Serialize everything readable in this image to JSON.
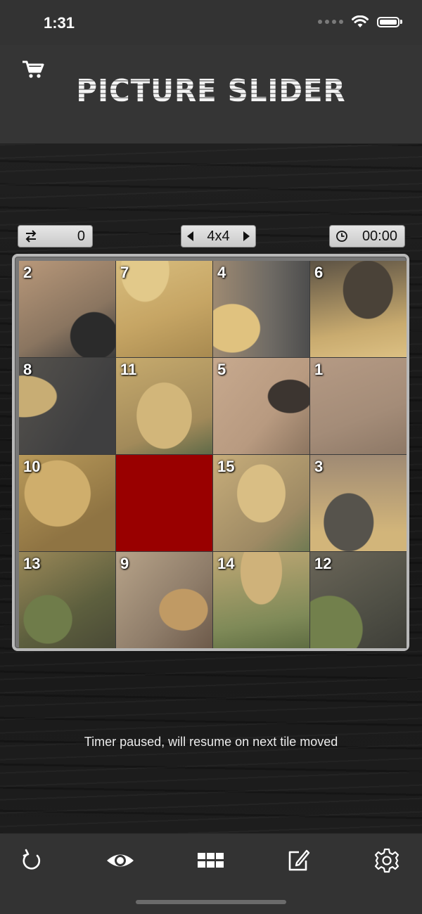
{
  "status": {
    "time": "1:31"
  },
  "header": {
    "title": "PICTURE SLIDER",
    "cart_icon": "cart-icon"
  },
  "hud": {
    "moves_value": "0",
    "size_label": "4x4",
    "timer_value": "00:00"
  },
  "board": {
    "rows": 4,
    "cols": 4,
    "blank_color": "#990000",
    "tiles": [
      {
        "num": "2"
      },
      {
        "num": "7"
      },
      {
        "num": "4"
      },
      {
        "num": "6"
      },
      {
        "num": "8"
      },
      {
        "num": "11"
      },
      {
        "num": "5"
      },
      {
        "num": "1"
      },
      {
        "num": "10"
      },
      {
        "num": ""
      },
      {
        "num": "15"
      },
      {
        "num": "3"
      },
      {
        "num": "13"
      },
      {
        "num": "9"
      },
      {
        "num": "14"
      },
      {
        "num": "12"
      }
    ]
  },
  "message": "Timer paused, will resume on next tile moved",
  "toolbar": {
    "items": [
      "restart-icon",
      "eye-icon",
      "grid-icon",
      "edit-icon",
      "gear-icon"
    ]
  }
}
